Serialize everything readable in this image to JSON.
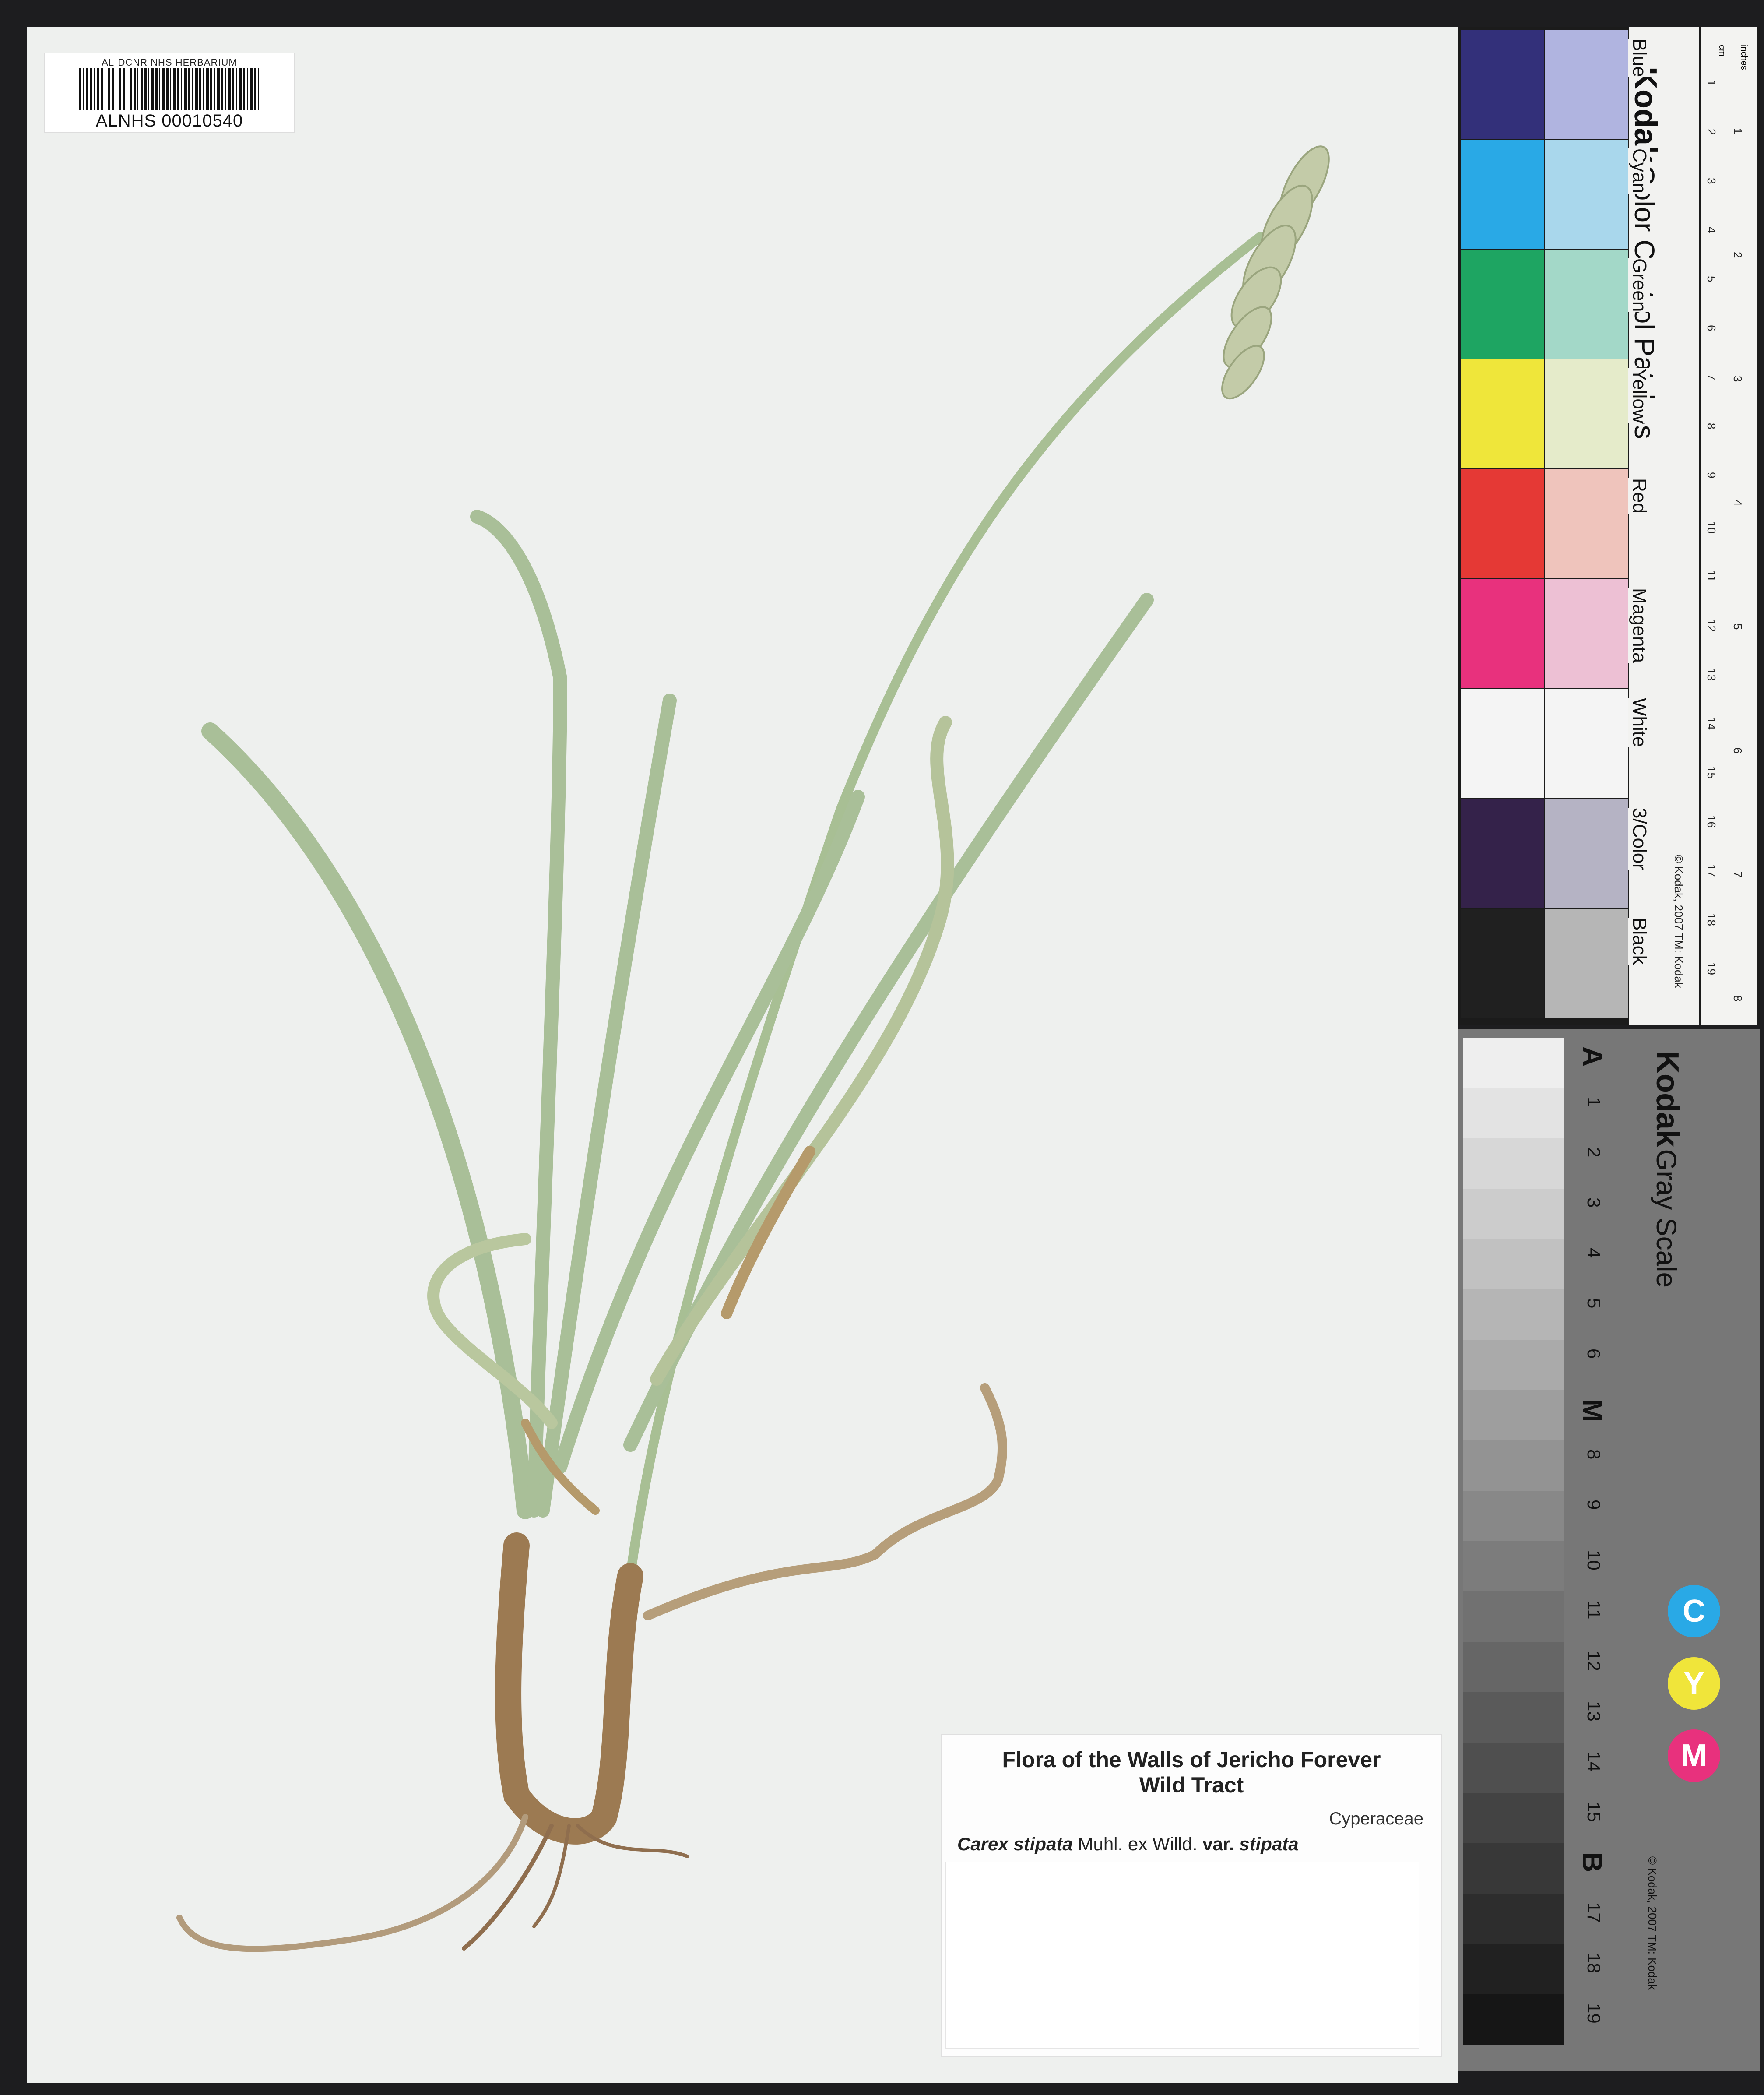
{
  "barcode": {
    "institution": "AL-DCNR NHS HERBARIUM",
    "catalog_number": "ALNHS 00010540"
  },
  "label": {
    "title_line1": "Flora of the Walls of Jericho Forever",
    "title_line2": "Wild Tract",
    "family": "Cyperaceae",
    "genus_species": "Carex stipata",
    "authority": "Muhl. ex Willd.",
    "rank": "var.",
    "infra": "stipata"
  },
  "color_card": {
    "brand": "Kodak",
    "title": "Color Control Patches",
    "patches": [
      {
        "name": "Blue",
        "dark": "#33307a",
        "light": "#b0b4e0"
      },
      {
        "name": "Cyan",
        "dark": "#29a9e6",
        "light": "#a9d7ec"
      },
      {
        "name": "Green",
        "dark": "#1ea562",
        "light": "#a3d8c8"
      },
      {
        "name": "Yellow",
        "dark": "#efe63a",
        "light": "#e5ebca"
      },
      {
        "name": "Red",
        "dark": "#e53935",
        "light": "#efc4bc"
      },
      {
        "name": "Magenta",
        "dark": "#e8317d",
        "light": "#edc0d4"
      },
      {
        "name": "White",
        "dark": "#f4f4f4",
        "light": "#f4f4f4"
      },
      {
        "name": "3/Color",
        "dark": "#34224a",
        "light": "#b5b3c4"
      },
      {
        "name": "Black",
        "dark": "#202020",
        "light": "#b6b6b6"
      }
    ],
    "copyright": "© Kodak, 2007 TM: Kodak",
    "ruler_cm": [
      "1",
      "2",
      "3",
      "4",
      "5",
      "6",
      "7",
      "8",
      "9",
      "10",
      "11",
      "12",
      "13",
      "14",
      "15",
      "16",
      "17",
      "18",
      "19"
    ],
    "ruler_inches": [
      "1",
      "2",
      "3",
      "4",
      "5",
      "6",
      "7",
      "8"
    ],
    "ruler_units_cm": "cm",
    "ruler_units_in": "inches"
  },
  "gray_card": {
    "brand": "Kodak",
    "title": "Gray Scale",
    "steps": [
      "A",
      "1",
      "2",
      "3",
      "4",
      "5",
      "6",
      "M",
      "8",
      "9",
      "10",
      "11",
      "12",
      "13",
      "14",
      "15",
      "B",
      "17",
      "18",
      "19"
    ],
    "cym": [
      "C",
      "Y",
      "M"
    ],
    "cym_colors": [
      "#29a9e6",
      "#f0e53a",
      "#e8317d"
    ],
    "copyright": "© Kodak, 2007 TM: Kodak"
  }
}
